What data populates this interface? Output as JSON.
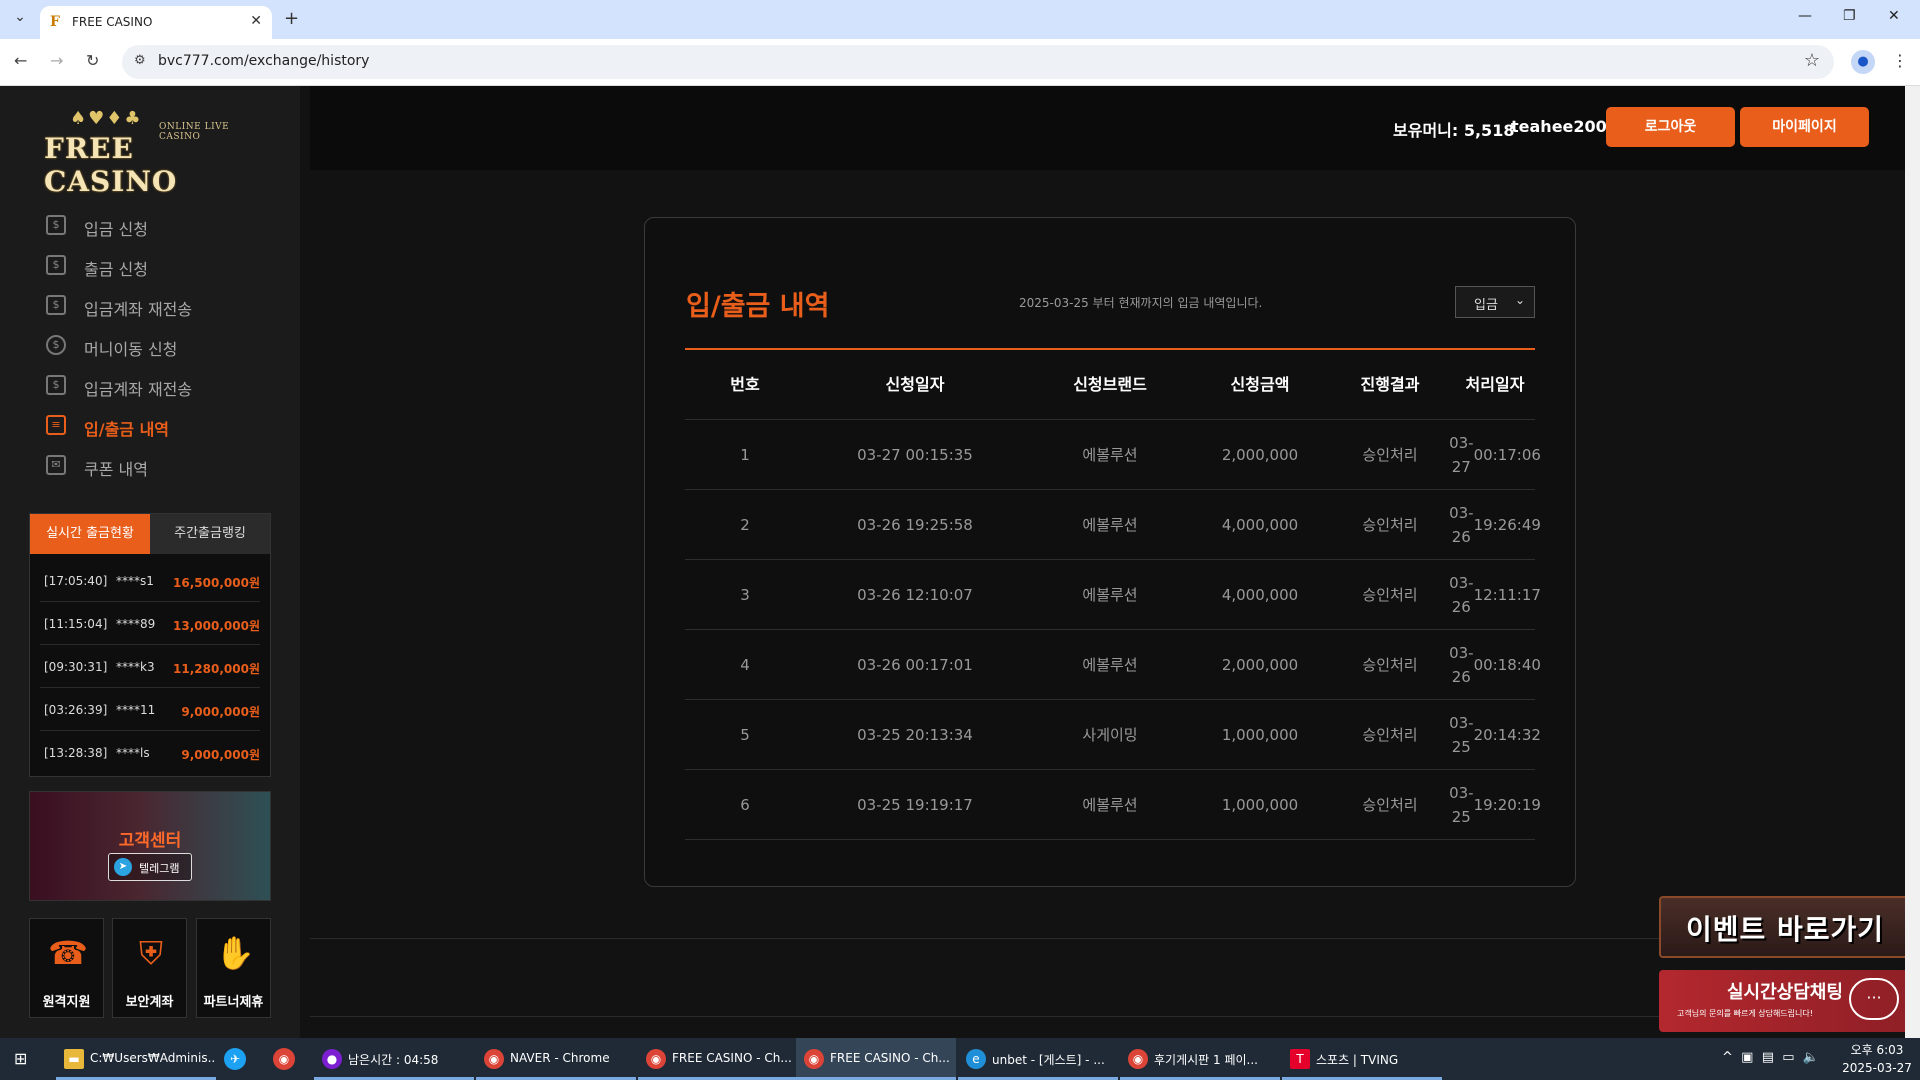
{
  "browser": {
    "tab_title": "FREE CASINO",
    "url": "bvc777.com/exchange/history"
  },
  "logo": {
    "main": "FREE CASINO",
    "sub": "ONLINE LIVE CASINO",
    "cards": "♠♥♦♣"
  },
  "sidebar": {
    "items": [
      {
        "label": "입금 신청",
        "icon": "deposit-icon"
      },
      {
        "label": "출금 신청",
        "icon": "withdraw-icon"
      },
      {
        "label": "입금계좌 재전송",
        "icon": "account-icon"
      },
      {
        "label": "머니이동 신청",
        "icon": "money-move-icon"
      },
      {
        "label": "입금계좌 재전송",
        "icon": "account-icon"
      },
      {
        "label": "입/출금 내역",
        "icon": "list-icon"
      },
      {
        "label": "쿠폰 내역",
        "icon": "coupon-icon"
      }
    ]
  },
  "ranking": {
    "tab_live": "실시간 출금현황",
    "tab_week": "주간출금랭킹",
    "rows": [
      {
        "time": "[17:05:40]",
        "user": "****s1",
        "amount": "16,500,000원"
      },
      {
        "time": "[11:15:04]",
        "user": "****89",
        "amount": "13,000,000원"
      },
      {
        "time": "[09:30:31]",
        "user": "****k3",
        "amount": "11,280,000원"
      },
      {
        "time": "[03:26:39]",
        "user": "****11",
        "amount": "9,000,000원"
      },
      {
        "time": "[13:28:38]",
        "user": "****ls",
        "amount": "9,000,000원"
      }
    ]
  },
  "support": {
    "title": "고객센터",
    "telegram": "텔레그램"
  },
  "quick": [
    {
      "label": "원격지원",
      "icon": "remote-support-icon"
    },
    {
      "label": "보안계좌",
      "icon": "shield-icon"
    },
    {
      "label": "파트너제휴",
      "icon": "handshake-icon"
    }
  ],
  "header": {
    "money": "보유머니: 5,518",
    "username": "teahee2005",
    "logout": "로그아웃",
    "mypage": "마이페이지"
  },
  "history": {
    "title": "입/출금 내역",
    "description": "2025-03-25 부터 현재까지의 입금 내역입니다.",
    "filter_value": "입금",
    "columns": [
      "번호",
      "신청일자",
      "신청브랜드",
      "신청금액",
      "진행결과",
      "처리일자"
    ],
    "rows": [
      [
        "1",
        "03-27 00:15:35",
        "에볼루션",
        "2,000,000",
        "승인처리",
        "03-27",
        "00:17:06"
      ],
      [
        "2",
        "03-26 19:25:58",
        "에볼루션",
        "4,000,000",
        "승인처리",
        "03-26",
        "19:26:49"
      ],
      [
        "3",
        "03-26 12:10:07",
        "에볼루션",
        "4,000,000",
        "승인처리",
        "03-26",
        "12:11:17"
      ],
      [
        "4",
        "03-26 00:17:01",
        "에볼루션",
        "2,000,000",
        "승인처리",
        "03-26",
        "00:18:40"
      ],
      [
        "5",
        "03-25 20:13:34",
        "사게이밍",
        "1,000,000",
        "승인처리",
        "03-25",
        "20:14:32"
      ],
      [
        "6",
        "03-25 19:19:17",
        "에볼루션",
        "1,000,000",
        "승인처리",
        "03-25",
        "19:20:19"
      ]
    ]
  },
  "banners": {
    "event": "이벤트 바로가기",
    "chat_title": "실시간상담채팅",
    "chat_sub": "고객님의 문의를 빠르게 상담해드립니다!"
  },
  "taskbar": {
    "items": [
      {
        "label": "C:₩Users₩Adminis...",
        "icon": "folder-icon",
        "color": "#e8b83a"
      },
      {
        "label": "남은시간 : 04:58",
        "icon": "timer-app-icon",
        "color": "#7b1fd1"
      },
      {
        "label": "NAVER - Chrome",
        "icon": "chrome-icon",
        "color": "#db4437"
      },
      {
        "label": "FREE CASINO - Ch...",
        "icon": "chrome-icon",
        "color": "#db4437"
      },
      {
        "label": "FREE CASINO - Ch...",
        "icon": "chrome-icon",
        "color": "#db4437"
      },
      {
        "label": "unbet - [게스트] - ...",
        "icon": "edge-icon",
        "color": "#1f8fd8"
      },
      {
        "label": "후기게시판 1 페이...",
        "icon": "chrome-icon",
        "color": "#db4437"
      },
      {
        "label": "스포츠 | TVING",
        "icon": "tving-icon",
        "color": "#e4002b"
      }
    ],
    "time": "오후 6:03",
    "date": "2025-03-27"
  },
  "colors": {
    "accent": "#e95e1b",
    "background": "#121212"
  }
}
